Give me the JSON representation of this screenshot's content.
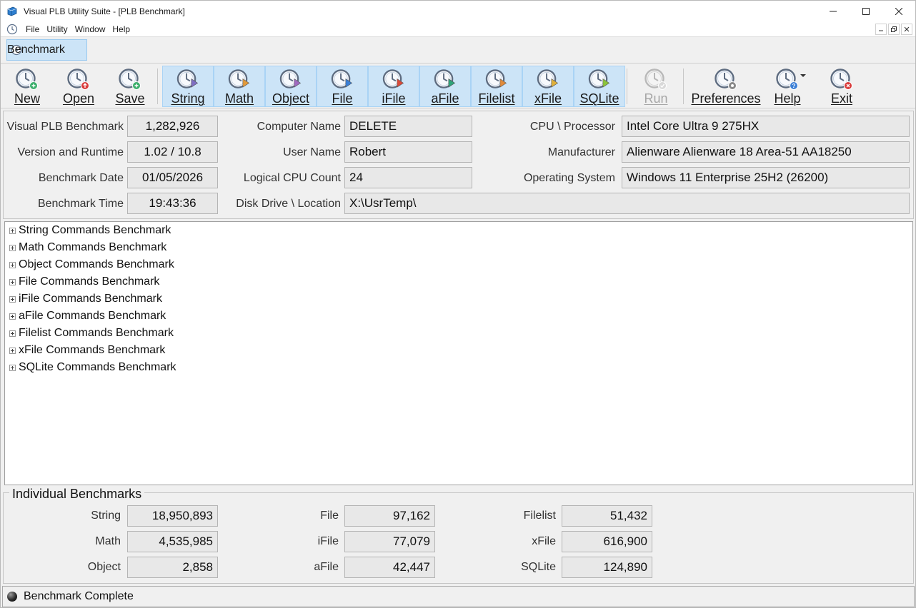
{
  "window": {
    "title": "Visual PLB Utility Suite - [PLB Benchmark]"
  },
  "menu": {
    "items": [
      "File",
      "Utility",
      "Window",
      "Help"
    ]
  },
  "doc_tab": {
    "label": "Benchmark"
  },
  "toolbar": {
    "buttons": [
      {
        "label": "New",
        "badge": "#3aae6b",
        "state": "normal"
      },
      {
        "label": "Open",
        "badge": "#d93b3b",
        "state": "normal"
      },
      {
        "label": "Save",
        "badge": "#3aae6b",
        "state": "normal"
      },
      {
        "label": "String",
        "flag": "#7f6fc4",
        "state": "selected"
      },
      {
        "label": "Math",
        "flag": "#e19a3a",
        "state": "selected"
      },
      {
        "label": "Object",
        "flag": "#a06bc0",
        "state": "selected"
      },
      {
        "label": "File",
        "flag": "#3b7fd6",
        "state": "selected"
      },
      {
        "label": "iFile",
        "flag": "#d94a3a",
        "state": "selected"
      },
      {
        "label": "aFile",
        "flag": "#2fa37a",
        "state": "selected"
      },
      {
        "label": "Filelist",
        "flag": "#e08a3a",
        "state": "selected"
      },
      {
        "label": "xFile",
        "flag": "#e0b13a",
        "state": "selected"
      },
      {
        "label": "SQLite",
        "flag": "#8cc43a",
        "state": "selected"
      },
      {
        "label": "Run",
        "state": "disabled"
      },
      {
        "label": "Preferences",
        "badge": "#8a8a8a",
        "state": "normal"
      },
      {
        "label": "Help",
        "badge": "#3b7fd6",
        "state": "normal"
      },
      {
        "label": "Exit",
        "badge": "#d93b3b",
        "state": "normal"
      }
    ]
  },
  "info": {
    "benchmark_label": "Visual PLB Benchmark",
    "benchmark_value": "1,282,926",
    "version_label": "Version and Runtime",
    "version_value": "1.02 / 10.8",
    "date_label": "Benchmark Date",
    "date_value": "01/05/2026",
    "time_label": "Benchmark Time",
    "time_value": "19:43:36",
    "computer_label": "Computer Name",
    "computer_value": "DELETE",
    "user_label": "User Name",
    "user_value": "Robert",
    "cpu_count_label": "Logical CPU Count",
    "cpu_count_value": "24",
    "disk_label": "Disk Drive \\ Location",
    "disk_value": "X:\\UsrTemp\\",
    "cpu_label": "CPU \\ Processor",
    "cpu_value": "Intel Core Ultra 9 275HX",
    "manufacturer_label": "Manufacturer",
    "manufacturer_value": "Alienware Alienware 18 Area-51 AA18250",
    "os_label": "Operating System",
    "os_value": "Windows 11 Enterprise 25H2 (26200)"
  },
  "tree": {
    "items": [
      "String Commands Benchmark",
      "Math Commands Benchmark",
      "Object Commands Benchmark",
      "File Commands Benchmark",
      "iFile Commands Benchmark",
      "aFile Commands Benchmark",
      "Filelist Commands Benchmark",
      "xFile Commands Benchmark",
      "SQLite Commands Benchmark"
    ]
  },
  "individual": {
    "title": "Individual Benchmarks",
    "results": [
      {
        "label": "String",
        "value": "18,950,893"
      },
      {
        "label": "Math",
        "value": "4,535,985"
      },
      {
        "label": "Object",
        "value": "2,858"
      },
      {
        "label": "File",
        "value": "97,162"
      },
      {
        "label": "iFile",
        "value": "77,079"
      },
      {
        "label": "aFile",
        "value": "42,447"
      },
      {
        "label": "Filelist",
        "value": "51,432"
      },
      {
        "label": "xFile",
        "value": "616,900"
      },
      {
        "label": "SQLite",
        "value": "124,890"
      }
    ]
  },
  "status": {
    "text": "Benchmark Complete"
  }
}
